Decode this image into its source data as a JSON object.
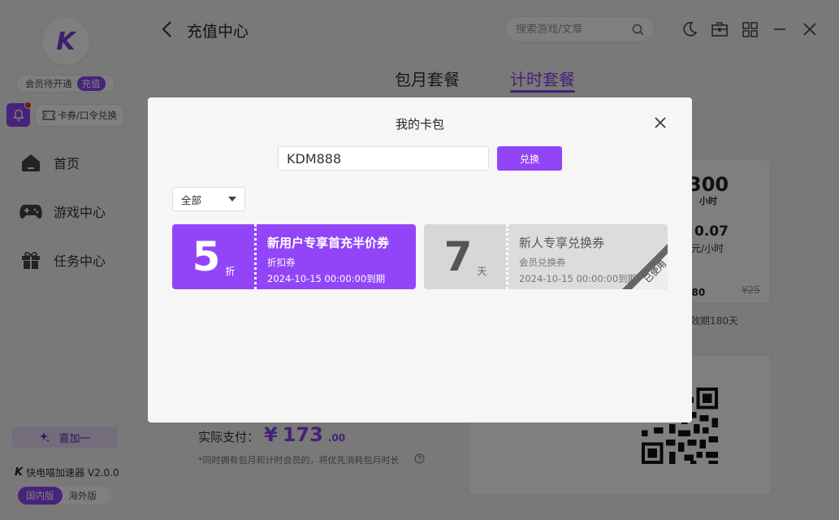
{
  "app": {
    "logo_letter": "K",
    "version_text": "快电喵加速器 V2.0.0"
  },
  "sidebar": {
    "member_status": "会员待开通",
    "charge_label": "充值",
    "redeem_label": "卡券/口令兑换",
    "nav": [
      {
        "label": "首页",
        "icon": "home-icon"
      },
      {
        "label": "游戏中心",
        "icon": "gamepad-icon"
      },
      {
        "label": "任务中心",
        "icon": "gift-icon"
      }
    ],
    "promo_label": "喜加一",
    "region_domestic": "国内版",
    "region_overseas": "海外版"
  },
  "header": {
    "title": "充值中心",
    "search_placeholder": "搜索游戏/文章"
  },
  "main": {
    "tabs": [
      {
        "label": "包月套餐"
      },
      {
        "label": "计时套餐"
      }
    ],
    "active_tab": 1,
    "plan": {
      "hours": "300",
      "hours_unit": "小时",
      "price_per": "0.07",
      "price_per_unit": "元/小时",
      "price_now": ".80",
      "price_old": "¥25"
    },
    "validity_text": "效期180天",
    "pay": {
      "label": "实际支付：",
      "currency": "¥",
      "amount": "173",
      "cents": ".00"
    },
    "note": "*同时拥有包月和计时会员的，将优先消耗包月时长"
  },
  "modal": {
    "title": "我的卡包",
    "code_value": "KDM888",
    "exchange_label": "兑换",
    "filter_value": "全部",
    "coupons": [
      {
        "value": "5",
        "unit": "折",
        "name": "新用户专享首充半价券",
        "type": "折扣券",
        "expiry": "2024-10-15 00:00:00到期",
        "status": "active"
      },
      {
        "value": "7",
        "unit": "天",
        "name": "新人专享兑换券",
        "type": "会员兑换券",
        "expiry": "2024-10-15 00:00:00到期",
        "status": "used",
        "status_label": "已使用"
      }
    ]
  },
  "colors": {
    "accent": "#9245f7",
    "accent_text": "#8a45ef",
    "badge_red": "#e5322f"
  }
}
